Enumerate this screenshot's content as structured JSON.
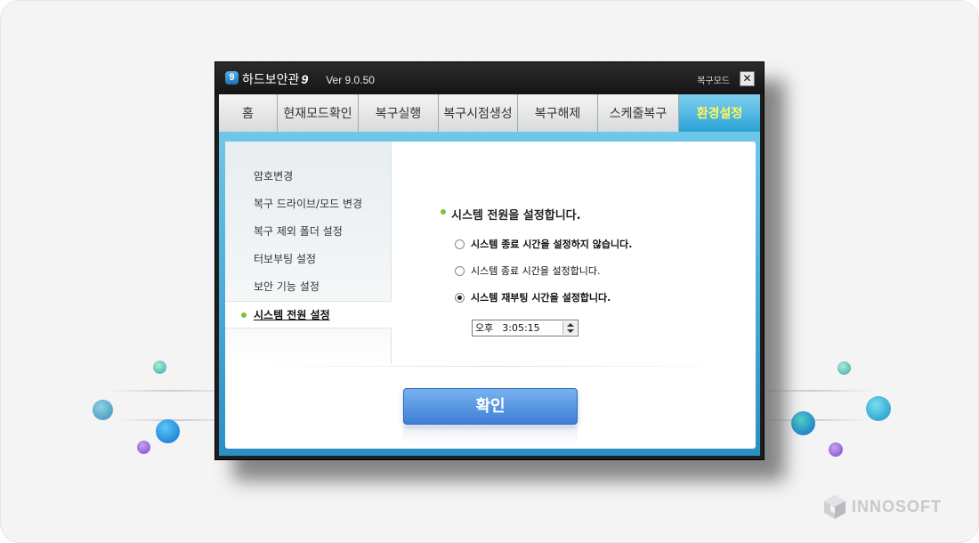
{
  "window": {
    "app_name": "하드보안관",
    "app_number": "9",
    "version": "Ver 9.0.50",
    "restore_mode_label": "복구모드",
    "close_symbol": "✕"
  },
  "tabs": [
    {
      "label": "홈",
      "active": false
    },
    {
      "label": "현재모드확인",
      "active": false
    },
    {
      "label": "복구실행",
      "active": false
    },
    {
      "label": "복구시점생성",
      "active": false
    },
    {
      "label": "복구해제",
      "active": false
    },
    {
      "label": "스케줄복구",
      "active": false
    },
    {
      "label": "환경설정",
      "active": true
    }
  ],
  "sidebar": {
    "items": [
      {
        "label": "암호변경",
        "active": false
      },
      {
        "label": "복구 드라이브/모드 변경",
        "active": false
      },
      {
        "label": "복구 제외 폴더 설정",
        "active": false
      },
      {
        "label": "터보부팅 설정",
        "active": false
      },
      {
        "label": "보안 기능 설정",
        "active": false
      },
      {
        "label": "시스템 전원 설정",
        "active": true
      }
    ]
  },
  "main": {
    "section_title": "시스템 전원을 설정합니다.",
    "options": [
      {
        "label": "시스템 종료 시간을 설정하지 않습니다.",
        "checked": false
      },
      {
        "label": "시스템 종료 시간을 설정합니다.",
        "checked": false
      },
      {
        "label": "시스템 재부팅 시간을 설정합니다.",
        "checked": true
      }
    ],
    "time": {
      "ampm": "오후",
      "value": "3:05:15"
    },
    "ok_label": "확인"
  },
  "brand": {
    "name": "INNOSOFT"
  },
  "colors": {
    "accent_tab": "#2aa3d6",
    "active_tab_text": "#fff65a",
    "bullet": "#7bc23f",
    "ok_button": "#3d7fd6"
  }
}
